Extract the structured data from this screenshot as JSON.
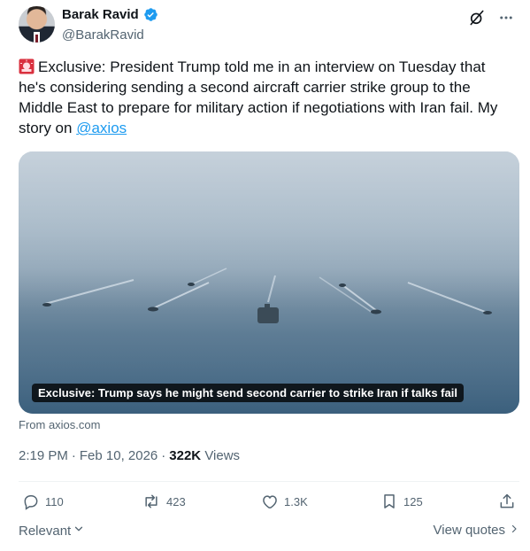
{
  "author": {
    "display_name": "Barak Ravid",
    "handle": "@BarakRavid",
    "verified": true,
    "avatar": "avatar-photo"
  },
  "top_icons": [
    "grok-icon",
    "more-icon"
  ],
  "tweet": {
    "emoji": "rotating-light-emoji",
    "text_main": "Exclusive: President Trump told me in an interview on Tuesday that he's considering sending a second aircraft carrier strike group to the Middle East to prepare for military action if negotiations with Iran fail. My story on ",
    "mention": "@axios"
  },
  "media": {
    "caption": "Exclusive: Trump says he might send second carrier to strike Iran if talks fail",
    "source": "From axios.com"
  },
  "meta": {
    "time": "2:19 PM",
    "separator1": "·",
    "date": "Feb 10, 2026",
    "separator2": "·",
    "views_count": "322K",
    "views_label": "Views"
  },
  "actions": {
    "replies": "110",
    "reposts": "423",
    "likes": "1.3K",
    "bookmarks": "125"
  },
  "footer": {
    "sort_label": "Relevant",
    "view_quotes_label": "View quotes"
  },
  "colors": {
    "accent": "#1d9bf0",
    "text_primary": "#0f1419",
    "text_secondary": "#536471"
  }
}
